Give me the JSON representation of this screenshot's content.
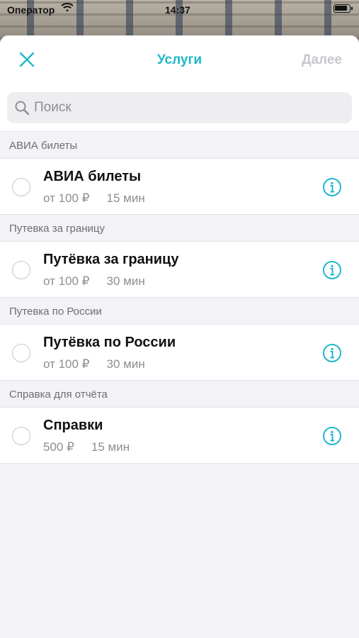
{
  "status_bar": {
    "carrier": "Оператор",
    "time": "14:37"
  },
  "navbar": {
    "title": "Услуги",
    "next_label": "Далее"
  },
  "search": {
    "placeholder": "Поиск"
  },
  "sections": [
    {
      "header": "АВИА билеты",
      "item": {
        "title": "АВИА билеты",
        "price": "от 100 ₽",
        "duration": "15 мин"
      }
    },
    {
      "header": "Путевка за границу",
      "item": {
        "title": "Путёвка за границу",
        "price": "от 100 ₽",
        "duration": "30 мин"
      }
    },
    {
      "header": "Путевка по России",
      "item": {
        "title": "Путёвка по России",
        "price": "от 100 ₽",
        "duration": "30 мин"
      }
    },
    {
      "header": "Справка для отчёта",
      "item": {
        "title": "Справки",
        "price": "500 ₽",
        "duration": "15 мин"
      }
    }
  ],
  "colors": {
    "accent": "#1fb8c9",
    "disabled": "#c7c7cc",
    "secondary_text": "#8e8e93"
  },
  "icons": {
    "close": "close-icon",
    "search": "search-icon",
    "info": "info-icon",
    "wifi": "wifi-icon",
    "battery": "battery-icon"
  }
}
